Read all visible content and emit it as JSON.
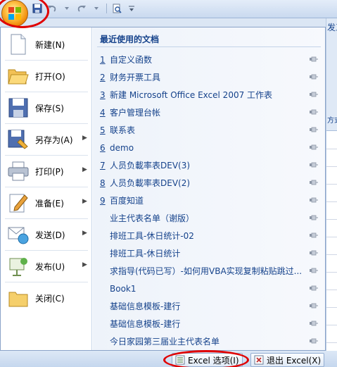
{
  "ribbon": {
    "tab_partial": "发工",
    "side_partial": "方式"
  },
  "menu": {
    "left_items": [
      {
        "label": "新建(N)",
        "has_arrow": false,
        "icon": "new-document-icon"
      },
      {
        "label": "打开(O)",
        "has_arrow": false,
        "icon": "open-folder-icon"
      },
      {
        "label": "保存(S)",
        "has_arrow": false,
        "icon": "save-disk-icon"
      },
      {
        "label": "另存为(A)",
        "has_arrow": true,
        "icon": "save-as-icon"
      },
      {
        "label": "打印(P)",
        "has_arrow": true,
        "icon": "printer-icon"
      },
      {
        "label": "准备(E)",
        "has_arrow": true,
        "icon": "prepare-pencil-icon"
      },
      {
        "label": "发送(D)",
        "has_arrow": true,
        "icon": "send-icon"
      },
      {
        "label": "发布(U)",
        "has_arrow": true,
        "icon": "publish-icon"
      },
      {
        "label": "关闭(C)",
        "has_arrow": false,
        "icon": "close-folder-icon"
      }
    ],
    "recent_title": "最近使用的文档",
    "recent": [
      {
        "num": "1",
        "name": "自定义函数"
      },
      {
        "num": "2",
        "name": "财务开票工具"
      },
      {
        "num": "3",
        "name": "新建 Microsoft Office Excel 2007 工作表"
      },
      {
        "num": "4",
        "name": "客户管理台帐"
      },
      {
        "num": "5",
        "name": "联系表"
      },
      {
        "num": "6",
        "name": "demo"
      },
      {
        "num": "7",
        "name": "人员负載率表DEV(3)"
      },
      {
        "num": "8",
        "name": "人员负載率表DEV(2)"
      },
      {
        "num": "9",
        "name": "百度知道"
      },
      {
        "num": "",
        "name": "业主代表名单（谢版）"
      },
      {
        "num": "",
        "name": "排班工具-休日统计-02"
      },
      {
        "num": "",
        "name": "排班工具-休日统计"
      },
      {
        "num": "",
        "name": "求指导(代码已写）-如何用VBA实现复制粘贴跳过..."
      },
      {
        "num": "",
        "name": "Book1"
      },
      {
        "num": "",
        "name": "基础信息模板-建行"
      },
      {
        "num": "",
        "name": "基础信息模板-建行"
      },
      {
        "num": "",
        "name": "今日家园第三届业主代表名单"
      }
    ]
  },
  "buttons": {
    "excel_options": "Excel 选项(I)",
    "exit_excel": "退出 Excel(X)"
  },
  "colors": {
    "link_blue": "#15428b",
    "highlight_red": "#e00000"
  }
}
